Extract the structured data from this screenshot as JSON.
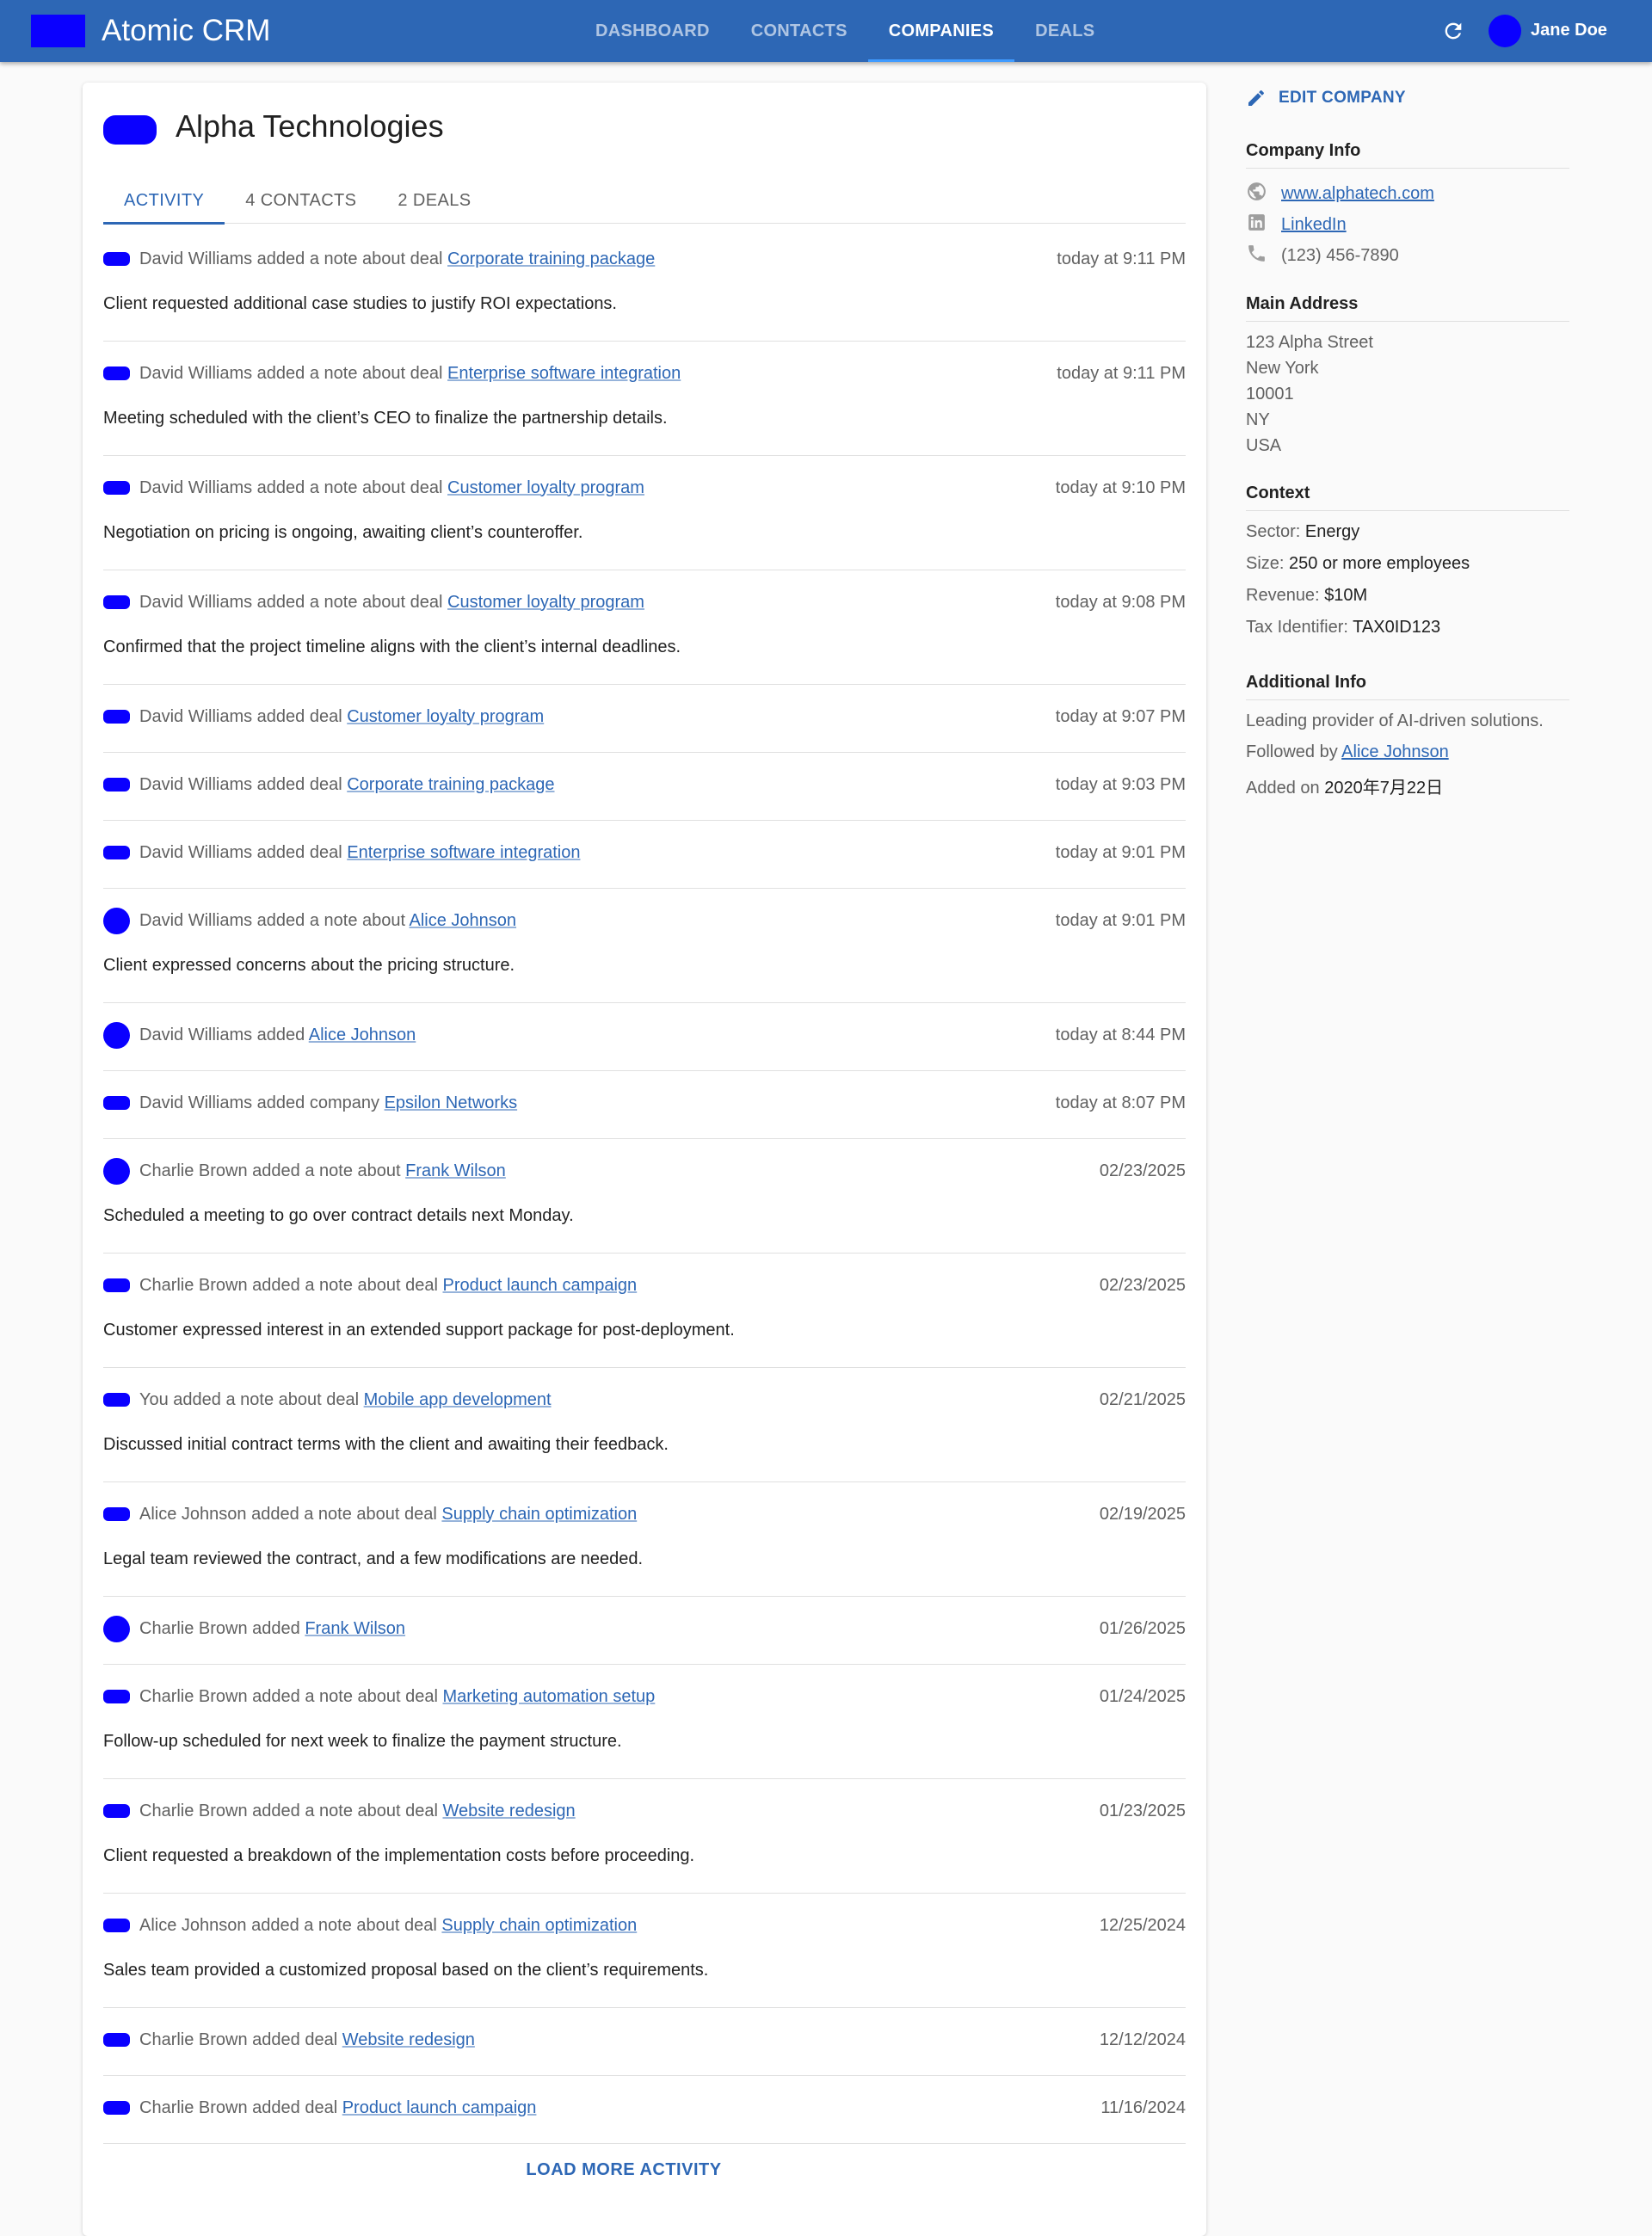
{
  "app": {
    "title": "Atomic CRM",
    "nav": [
      "DASHBOARD",
      "CONTACTS",
      "COMPANIES",
      "DEALS"
    ],
    "active_nav": "COMPANIES",
    "user": "Jane Doe",
    "colors": {
      "primary": "#2d67b5",
      "placeholder": "#0a00ff"
    }
  },
  "company": {
    "name": "Alpha Technologies",
    "tabs": [
      "ACTIVITY",
      "4 CONTACTS",
      "2 DEALS"
    ],
    "active_tab": "ACTIVITY"
  },
  "activity": [
    {
      "icon": "deal",
      "prefix": "David Williams added a note about deal",
      "link": "Corporate training package",
      "date": "today at 9:11 PM",
      "note": "Client requested additional case studies to justify ROI expectations."
    },
    {
      "icon": "deal",
      "prefix": "David Williams added a note about deal",
      "link": "Enterprise software integration",
      "date": "today at 9:11 PM",
      "note": "Meeting scheduled with the client’s CEO to finalize the partnership details."
    },
    {
      "icon": "deal",
      "prefix": "David Williams added a note about deal",
      "link": "Customer loyalty program",
      "date": "today at 9:10 PM",
      "note": "Negotiation on pricing is ongoing, awaiting client’s counteroffer."
    },
    {
      "icon": "deal",
      "prefix": "David Williams added a note about deal",
      "link": "Customer loyalty program",
      "date": "today at 9:08 PM",
      "note": "Confirmed that the project timeline aligns with the client’s internal deadlines."
    },
    {
      "icon": "deal",
      "prefix": "David Williams added deal",
      "link": "Customer loyalty program",
      "date": "today at 9:07 PM",
      "note": ""
    },
    {
      "icon": "deal",
      "prefix": "David Williams added deal",
      "link": "Corporate training package",
      "date": "today at 9:03 PM",
      "note": ""
    },
    {
      "icon": "deal",
      "prefix": "David Williams added deal",
      "link": "Enterprise software integration",
      "date": "today at 9:01 PM",
      "note": ""
    },
    {
      "icon": "contact",
      "prefix": "David Williams added a note about",
      "link": "Alice Johnson",
      "date": "today at 9:01 PM",
      "note": "Client expressed concerns about the pricing structure."
    },
    {
      "icon": "contact",
      "prefix": "David Williams added",
      "link": "Alice Johnson",
      "date": "today at 8:44 PM",
      "note": ""
    },
    {
      "icon": "deal",
      "prefix": "David Williams added company",
      "link": "Epsilon Networks",
      "date": "today at 8:07 PM",
      "note": ""
    },
    {
      "icon": "contact",
      "prefix": "Charlie Brown added a note about",
      "link": "Frank Wilson",
      "date": "02/23/2025",
      "note": "Scheduled a meeting to go over contract details next Monday."
    },
    {
      "icon": "deal",
      "prefix": "Charlie Brown added a note about deal",
      "link": "Product launch campaign",
      "date": "02/23/2025",
      "note": "Customer expressed interest in an extended support package for post-deployment."
    },
    {
      "icon": "deal",
      "prefix": "You added a note about deal",
      "link": "Mobile app development",
      "date": "02/21/2025",
      "note": "Discussed initial contract terms with the client and awaiting their feedback."
    },
    {
      "icon": "deal",
      "prefix": "Alice Johnson added a note about deal",
      "link": "Supply chain optimization",
      "date": "02/19/2025",
      "note": "Legal team reviewed the contract, and a few modifications are needed."
    },
    {
      "icon": "contact",
      "prefix": "Charlie Brown added",
      "link": "Frank Wilson",
      "date": "01/26/2025",
      "note": ""
    },
    {
      "icon": "deal",
      "prefix": "Charlie Brown added a note about deal",
      "link": "Marketing automation setup",
      "date": "01/24/2025",
      "note": "Follow-up scheduled for next week to finalize the payment structure."
    },
    {
      "icon": "deal",
      "prefix": "Charlie Brown added a note about deal",
      "link": "Website redesign",
      "date": "01/23/2025",
      "note": "Client requested a breakdown of the implementation costs before proceeding."
    },
    {
      "icon": "deal",
      "prefix": "Alice Johnson added a note about deal",
      "link": "Supply chain optimization",
      "date": "12/25/2024",
      "note": "Sales team provided a customized proposal based on the client’s requirements."
    },
    {
      "icon": "deal",
      "prefix": "Charlie Brown added deal",
      "link": "Website redesign",
      "date": "12/12/2024",
      "note": ""
    },
    {
      "icon": "deal",
      "prefix": "Charlie Brown added deal",
      "link": "Product launch campaign",
      "date": "11/16/2024",
      "note": ""
    }
  ],
  "load_more": "LOAD MORE ACTIVITY",
  "aside": {
    "edit_label": "EDIT COMPANY",
    "company_info": {
      "title": "Company Info",
      "website": "www.alphatech.com",
      "linkedin": "LinkedIn",
      "phone": "(123) 456-7890"
    },
    "address": {
      "title": "Main Address",
      "lines": [
        "123 Alpha Street",
        "New York",
        "10001",
        "NY",
        "USA"
      ]
    },
    "context": {
      "title": "Context",
      "rows": [
        {
          "label": "Sector:",
          "value": "Energy"
        },
        {
          "label": "Size:",
          "value": "250 or more employees"
        },
        {
          "label": "Revenue:",
          "value": "$10M"
        },
        {
          "label": "Tax Identifier:",
          "value": "TAX0ID123"
        }
      ]
    },
    "additional": {
      "title": "Additional Info",
      "description": "Leading provider of AI-driven solutions.",
      "followed_label": "Followed by",
      "followed_by": "Alice Johnson",
      "added_label": "Added on",
      "added_on": "2020年7月22日"
    }
  }
}
